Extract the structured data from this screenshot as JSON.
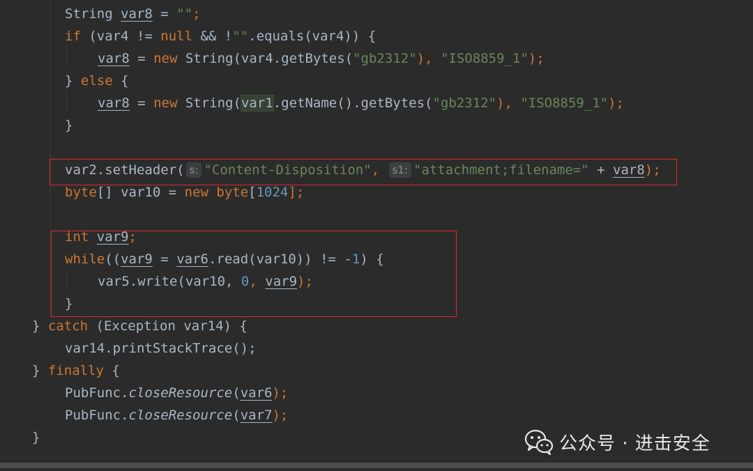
{
  "lines": [
    {
      "indent": 2,
      "tokens": [
        {
          "t": "String ",
          "c": "pl"
        },
        {
          "t": "var8",
          "c": "pl ul"
        },
        {
          "t": " = ",
          "c": "pl"
        },
        {
          "t": "\"\"",
          "c": "str"
        },
        {
          "t": ";",
          "c": "kw"
        }
      ]
    },
    {
      "indent": 2,
      "tokens": [
        {
          "t": "if",
          "c": "kw"
        },
        {
          "t": " (var4 != ",
          "c": "pl"
        },
        {
          "t": "null",
          "c": "kw"
        },
        {
          "t": " && !",
          "c": "pl"
        },
        {
          "t": "\"\"",
          "c": "str"
        },
        {
          "t": ".equals(var4)) {",
          "c": "pl"
        }
      ]
    },
    {
      "indent": 3,
      "tokens": [
        {
          "t": "var8",
          "c": "pl ul"
        },
        {
          "t": " = ",
          "c": "pl"
        },
        {
          "t": "new",
          "c": "kw"
        },
        {
          "t": " String(var4.getBytes(",
          "c": "pl"
        },
        {
          "t": "\"gb2312\"",
          "c": "str"
        },
        {
          "t": "), ",
          "c": "kw"
        },
        {
          "t": "\"ISO8859_1\"",
          "c": "str"
        },
        {
          "t": ");",
          "c": "kw"
        }
      ]
    },
    {
      "indent": 2,
      "tokens": [
        {
          "t": "} ",
          "c": "pl"
        },
        {
          "t": "else",
          "c": "kw"
        },
        {
          "t": " {",
          "c": "pl"
        }
      ]
    },
    {
      "indent": 3,
      "tokens": [
        {
          "t": "var8",
          "c": "pl ul"
        },
        {
          "t": " = ",
          "c": "pl"
        },
        {
          "t": "new",
          "c": "kw"
        },
        {
          "t": " String(",
          "c": "pl"
        },
        {
          "t": "var1",
          "c": "pl hl"
        },
        {
          "t": ".getName().getBytes(",
          "c": "pl"
        },
        {
          "t": "\"gb2312\"",
          "c": "str"
        },
        {
          "t": "), ",
          "c": "kw"
        },
        {
          "t": "\"ISO8859_1\"",
          "c": "str"
        },
        {
          "t": ");",
          "c": "kw"
        }
      ]
    },
    {
      "indent": 2,
      "tokens": [
        {
          "t": "}",
          "c": "pl"
        }
      ]
    },
    {
      "indent": 2,
      "tokens": []
    },
    {
      "indent": 2,
      "tokens": [
        {
          "t": "var2.setHeader(",
          "c": "pl"
        },
        {
          "hint": "s:"
        },
        {
          "t": "\"Content-Disposition\"",
          "c": "str"
        },
        {
          "t": ", ",
          "c": "kw"
        },
        {
          "hint": "s1:"
        },
        {
          "t": "\"attachment;filename=\"",
          "c": "str"
        },
        {
          "t": " + ",
          "c": "pl"
        },
        {
          "t": "var8",
          "c": "pl ul"
        },
        {
          "t": ");",
          "c": "kw"
        }
      ]
    },
    {
      "indent": 2,
      "tokens": [
        {
          "t": "byte",
          "c": "kw"
        },
        {
          "t": "[] var10 = ",
          "c": "pl"
        },
        {
          "t": "new",
          "c": "kw"
        },
        {
          "t": " ",
          "c": "pl"
        },
        {
          "t": "byte",
          "c": "kw"
        },
        {
          "t": "[",
          "c": "pl"
        },
        {
          "t": "1024",
          "c": "num"
        },
        {
          "t": "];",
          "c": "kw"
        }
      ]
    },
    {
      "indent": 2,
      "tokens": []
    },
    {
      "indent": 2,
      "tokens": [
        {
          "t": "int",
          "c": "kw"
        },
        {
          "t": " ",
          "c": "pl"
        },
        {
          "t": "var9",
          "c": "pl ul"
        },
        {
          "t": ";",
          "c": "kw"
        }
      ]
    },
    {
      "indent": 2,
      "tokens": [
        {
          "t": "while",
          "c": "kw"
        },
        {
          "t": "((",
          "c": "pl"
        },
        {
          "t": "var9",
          "c": "pl ul"
        },
        {
          "t": " = ",
          "c": "pl"
        },
        {
          "t": "var6",
          "c": "pl ul"
        },
        {
          "t": ".read(var10)) != -",
          "c": "pl"
        },
        {
          "t": "1",
          "c": "num"
        },
        {
          "t": ") {",
          "c": "pl"
        }
      ]
    },
    {
      "indent": 3,
      "tokens": [
        {
          "t": "var5.write(var10, ",
          "c": "pl"
        },
        {
          "t": "0",
          "c": "num"
        },
        {
          "t": ", ",
          "c": "kw"
        },
        {
          "t": "var9",
          "c": "pl ul"
        },
        {
          "t": ");",
          "c": "kw"
        }
      ]
    },
    {
      "indent": 2,
      "tokens": [
        {
          "t": "}",
          "c": "pl"
        }
      ]
    },
    {
      "indent": 1,
      "tokens": [
        {
          "t": "} ",
          "c": "pl"
        },
        {
          "t": "catch",
          "c": "kw"
        },
        {
          "t": " (Exception var14) {",
          "c": "pl"
        }
      ]
    },
    {
      "indent": 2,
      "tokens": [
        {
          "t": "var14.printStackTrace();",
          "c": "pl"
        }
      ]
    },
    {
      "indent": 1,
      "tokens": [
        {
          "t": "} ",
          "c": "pl"
        },
        {
          "t": "finally",
          "c": "kw"
        },
        {
          "t": " {",
          "c": "pl"
        }
      ]
    },
    {
      "indent": 2,
      "tokens": [
        {
          "t": "PubFunc.",
          "c": "pl"
        },
        {
          "t": "closeResource",
          "c": "ital"
        },
        {
          "t": "(",
          "c": "pl"
        },
        {
          "t": "var6",
          "c": "pl ul"
        },
        {
          "t": ");",
          "c": "kw"
        }
      ]
    },
    {
      "indent": 2,
      "tokens": [
        {
          "t": "PubFunc.",
          "c": "pl"
        },
        {
          "t": "closeResource",
          "c": "ital"
        },
        {
          "t": "(",
          "c": "pl"
        },
        {
          "t": "var7",
          "c": "pl ul"
        },
        {
          "t": ");",
          "c": "kw"
        }
      ]
    },
    {
      "indent": 1,
      "tokens": [
        {
          "t": "}",
          "c": "pl"
        }
      ]
    }
  ],
  "watermark": {
    "icon": "wechat-icon",
    "text": "公众号 · 进击安全"
  },
  "colors": {
    "background": "#2b2b2b",
    "keyword": "#cc7832",
    "string": "#6a8759",
    "number": "#6897bb",
    "identifier": "#a9b7c6",
    "highlight_box": "#e0262d"
  }
}
